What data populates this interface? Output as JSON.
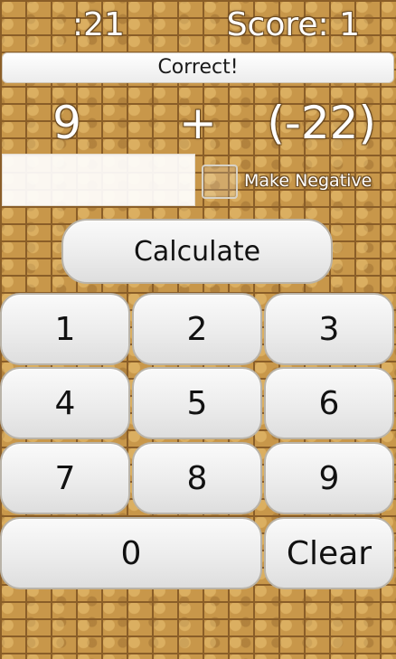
{
  "header": {
    "timer": ":21",
    "score": "Score: 1"
  },
  "status": {
    "message": "Correct!"
  },
  "problem": {
    "operand_a": "9",
    "operator": "+",
    "operand_b": "(-22)"
  },
  "answer": {
    "value": "",
    "placeholder": ""
  },
  "negative_toggle": {
    "label": "Make Negative",
    "checked": false
  },
  "actions": {
    "calculate_label": "Calculate"
  },
  "keypad": {
    "k1": "1",
    "k2": "2",
    "k3": "3",
    "k4": "4",
    "k5": "5",
    "k6": "6",
    "k7": "7",
    "k8": "8",
    "k9": "9",
    "k0": "0",
    "clear": "Clear"
  },
  "colors": {
    "brick": "#c8974a",
    "mortar": "#8a5e28",
    "button_face": "#ececec",
    "button_border": "#b9b3a8"
  }
}
